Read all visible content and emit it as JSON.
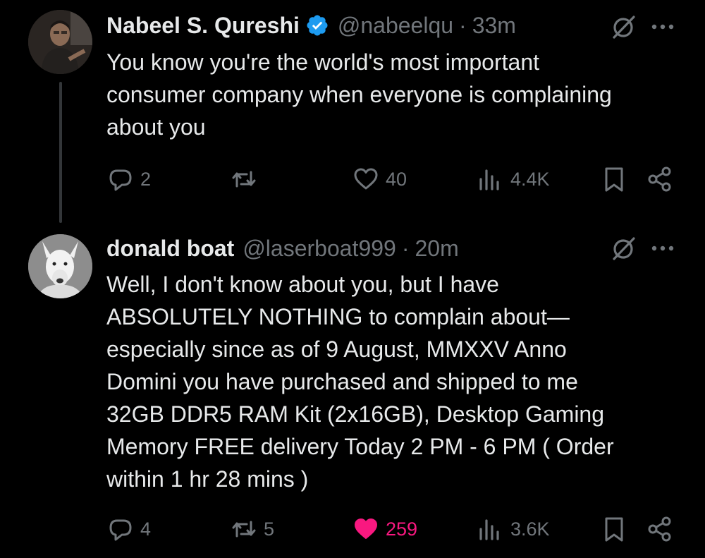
{
  "colors": {
    "background": "#000000",
    "text": "#e7e9ea",
    "muted": "#71767b",
    "verified": "#1d9bf0",
    "like_active": "#f91880",
    "thread_line": "#333639"
  },
  "tweets": [
    {
      "author_name": "Nabeel S. Qureshi",
      "verified": true,
      "handle": "@nabeelqu",
      "separator": "·",
      "time": "33m",
      "text_lines": [
        "You know you're the world's most important",
        "consumer company when everyone is complaining",
        "about you"
      ],
      "replies": "2",
      "retweets": "",
      "likes": "40",
      "liked": false,
      "views": "4.4K",
      "icons": [
        "grok-icon",
        "more-icon",
        "reply-icon",
        "retweet-icon",
        "heart-icon",
        "views-icon",
        "bookmark-icon",
        "share-icon"
      ]
    },
    {
      "author_name": "donald boat",
      "verified": false,
      "handle": "@laserboat999",
      "separator": "·",
      "time": "20m",
      "text_lines": [
        "Well, I don't know about you, but I have",
        "ABSOLUTELY NOTHING to complain about—",
        "especially since as of 9 August, MMXXV Anno",
        "Domini you have purchased and shipped to me",
        "32GB DDR5 RAM Kit (2x16GB), Desktop Gaming",
        "Memory FREE delivery Today 2 PM - 6 PM ( Order",
        "within 1 hr 28 mins )"
      ],
      "replies": "4",
      "retweets": "5",
      "likes": "259",
      "liked": true,
      "views": "3.6K",
      "icons": [
        "grok-icon",
        "more-icon",
        "reply-icon",
        "retweet-icon",
        "heart-icon",
        "views-icon",
        "bookmark-icon",
        "share-icon"
      ]
    }
  ]
}
